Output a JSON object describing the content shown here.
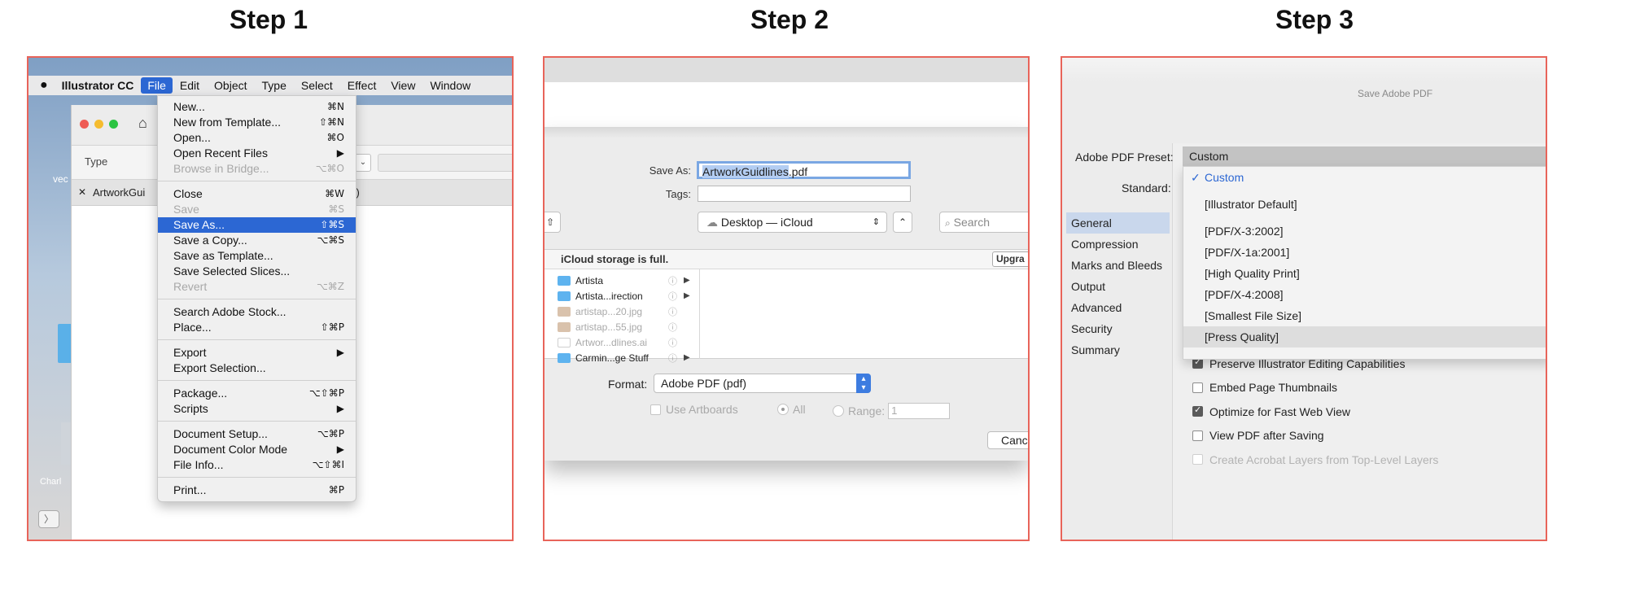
{
  "steps": [
    "Step 1",
    "Step 2",
    "Step 3"
  ],
  "step1": {
    "menubar": {
      "apple": "",
      "app": "Illustrator CC",
      "items": [
        "File",
        "Edit",
        "Object",
        "Type",
        "Select",
        "Effect",
        "View",
        "Window"
      ]
    },
    "window": {
      "type_label": "Type",
      "tab_label": "ArtworkGui",
      "tab_close": "✕",
      "view_fragment": "iew)",
      "desktop_label_left": "vec",
      "desktop_label_bottom": "Charl",
      "nav_arrow": "〉"
    },
    "file_menu": [
      {
        "label": "New...",
        "shortcut": "⌘N"
      },
      {
        "label": "New from Template...",
        "shortcut": "⇧⌘N"
      },
      {
        "label": "Open...",
        "shortcut": "⌘O"
      },
      {
        "label": "Open Recent Files",
        "shortcut": "▶"
      },
      {
        "label": "Browse in Bridge...",
        "shortcut": "⌥⌘O",
        "disabled": true
      },
      {
        "sep": true
      },
      {
        "label": "Close",
        "shortcut": "⌘W"
      },
      {
        "label": "Save",
        "shortcut": "⌘S",
        "disabled": true
      },
      {
        "label": "Save As...",
        "shortcut": "⇧⌘S",
        "selected": true
      },
      {
        "label": "Save a Copy...",
        "shortcut": "⌥⌘S"
      },
      {
        "label": "Save as Template...",
        "shortcut": ""
      },
      {
        "label": "Save Selected Slices...",
        "shortcut": ""
      },
      {
        "label": "Revert",
        "shortcut": "⌥⌘Z",
        "disabled": true
      },
      {
        "sep": true
      },
      {
        "label": "Search Adobe Stock...",
        "shortcut": ""
      },
      {
        "label": "Place...",
        "shortcut": "⇧⌘P"
      },
      {
        "sep": true
      },
      {
        "label": "Export",
        "shortcut": "▶"
      },
      {
        "label": "Export Selection...",
        "shortcut": ""
      },
      {
        "sep": true
      },
      {
        "label": "Package...",
        "shortcut": "⌥⇧⌘P"
      },
      {
        "label": "Scripts",
        "shortcut": "▶"
      },
      {
        "sep": true
      },
      {
        "label": "Document Setup...",
        "shortcut": "⌥⌘P"
      },
      {
        "label": "Document Color Mode",
        "shortcut": "▶"
      },
      {
        "label": "File Info...",
        "shortcut": "⌥⇧⌘I"
      },
      {
        "sep": true
      },
      {
        "label": "Print...",
        "shortcut": "⌘P"
      }
    ]
  },
  "step2": {
    "save_as_label": "Save As:",
    "save_as_selected": "ArtworkGuidlines",
    "save_as_ext": ".pdf",
    "tags_label": "Tags:",
    "tags_value": "",
    "path_button": "⇧",
    "location": "Desktop — iCloud",
    "location_stepper": "⌃",
    "search_placeholder": "Search",
    "icloud_notice": "iCloud storage is full.",
    "upgrade_label": "Upgra",
    "files": [
      {
        "name": "Artista",
        "kind": "folder",
        "dim": false,
        "arrow": "▶"
      },
      {
        "name": "Artista...irection",
        "kind": "folder",
        "dim": false,
        "arrow": "▶"
      },
      {
        "name": "artistap...20.jpg",
        "kind": "image",
        "dim": true,
        "arrow": ""
      },
      {
        "name": "artistap...55.jpg",
        "kind": "image",
        "dim": true,
        "arrow": ""
      },
      {
        "name": "Artwor...dlines.ai",
        "kind": "doc",
        "dim": true,
        "arrow": ""
      },
      {
        "name": "Carmin...ge Stuff",
        "kind": "folder",
        "dim": false,
        "arrow": "▶"
      }
    ],
    "info_icon": "ⓘ",
    "format_label": "Format:",
    "format_value": "Adobe PDF (pdf)",
    "use_artboards": "Use Artboards",
    "all_label": "All",
    "range_label": "Range:",
    "range_value": "1",
    "cancel_label": "Canc"
  },
  "step3": {
    "dialog_title": "Save Adobe PDF",
    "preset_label": "Adobe PDF Preset:",
    "preset_value": "Custom",
    "standard_label": "Standard:",
    "sidebar": [
      "General",
      "Compression",
      "Marks and Bleeds",
      "Output",
      "Advanced",
      "Security",
      "Summary"
    ],
    "sidebar_selected": "General",
    "presets": [
      {
        "label": "Custom",
        "current": true
      },
      {
        "sep": true
      },
      {
        "label": "[Illustrator Default]"
      },
      {
        "sep": true
      },
      {
        "label": "[PDF/X-3:2002]"
      },
      {
        "label": "[PDF/X-1a:2001]"
      },
      {
        "label": "[High Quality Print]"
      },
      {
        "label": "[PDF/X-4:2008]"
      },
      {
        "label": "[Smallest File Size]"
      },
      {
        "label": "[Press Quality]",
        "hover": true
      }
    ],
    "checkmark": "✓",
    "options": [
      {
        "label": "Preserve Illustrator Editing Capabilities",
        "checked": true,
        "disabled": false
      },
      {
        "label": "Embed Page Thumbnails",
        "checked": false,
        "disabled": false
      },
      {
        "label": "Optimize for Fast Web View",
        "checked": true,
        "disabled": false
      },
      {
        "label": "View PDF after Saving",
        "checked": false,
        "disabled": false
      },
      {
        "label": "Create Acrobat Layers from Top-Level Layers",
        "checked": false,
        "disabled": true
      }
    ]
  },
  "colors": {
    "panel_border": "#e8645a",
    "menu_highlight": "#2c67d3",
    "focus_ring": "#7aa7e3"
  }
}
